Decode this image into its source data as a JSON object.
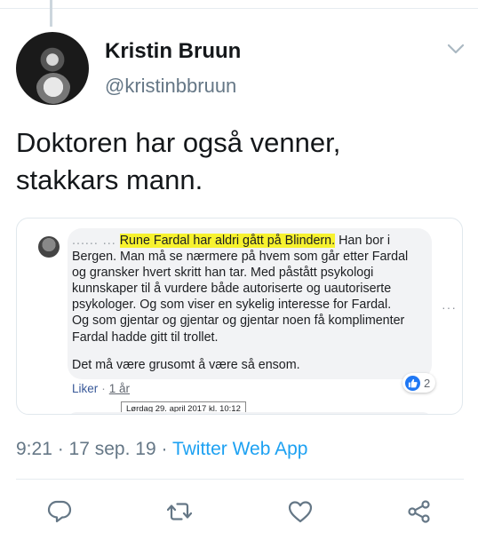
{
  "author": {
    "display_name": "Kristin Bruun",
    "handle": "@kristinbbruun"
  },
  "tweet": {
    "text_line1": "Doktoren har også venner,",
    "text_line2": "stakkars mann."
  },
  "embed": {
    "comment": {
      "author_name_obscured": "......   ...",
      "highlighted_sentence": "Rune Fardal har aldri gått på Blindern.",
      "line1_rest": " Han bor i",
      "lines": [
        "Bergen. Man må se nærmere på hvem som går etter Fardal",
        "og gransker hvert skritt han tar. Med påstått psykologi",
        "kunnskaper til å vurdere både autoriserte og uautoriserte",
        "psykologer. Og som viser en sykelig interesse for Fardal.",
        "Og som gjentar og gjentar og gjentar noen få komplimenter",
        "Fardal hadde gitt til trollet."
      ],
      "last_paragraph": "Det må være grusomt å være så ensom."
    },
    "like_label": "Liker",
    "separator": "·",
    "time_label": "1 år",
    "reaction_count": "2",
    "tooltip": "Lørdag 29. april 2017 kl. 10:12",
    "more_icon": "more-dots-icon"
  },
  "meta": {
    "time": "9:21",
    "date": "17 sep. 19",
    "source": "Twitter Web App",
    "separator": " · "
  },
  "icons": {
    "chevron": "chevron-down-icon",
    "reply": "reply-icon",
    "retweet": "retweet-icon",
    "like": "heart-icon",
    "share": "share-icon"
  },
  "colors": {
    "accent": "#1da1f2",
    "icon": "#657786",
    "highlight": "#f7f22f",
    "facebook_blue": "#2078f4"
  }
}
